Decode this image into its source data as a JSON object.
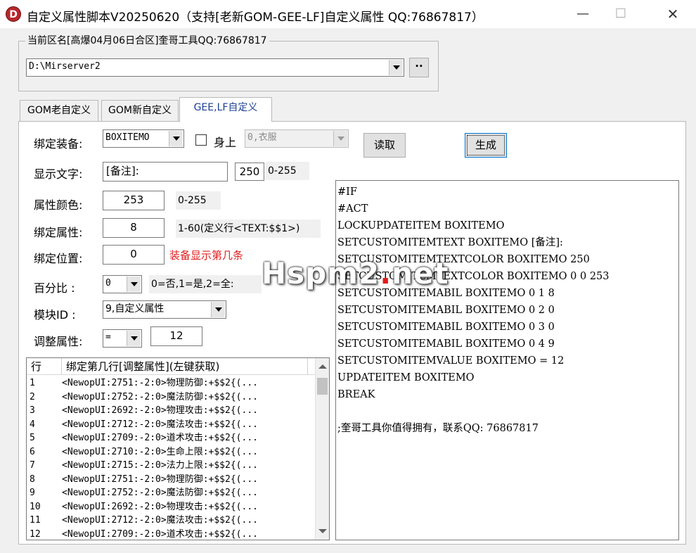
{
  "window": {
    "title": "自定义属性脚本V20250620（支持[老新GOM-GEE-LF]自定义属性 QQ:76867817）",
    "icon_letter": "D",
    "minimize": "—",
    "maximize": "☐",
    "close": "✕"
  },
  "server_group": {
    "legend": "当前区名[高爆04月06日合区]奎哥工具QQ:76867817",
    "path": "D:\\Mirserver2",
    "browse_label": "··"
  },
  "tabs": [
    {
      "label": "GOM老自定义"
    },
    {
      "label": "GOM新自定义"
    },
    {
      "label": "GEE,LF自定义"
    }
  ],
  "form": {
    "bind_equip_label": "绑定装备:",
    "bind_equip_value": "BOXITEMO",
    "on_body_label": "身上",
    "on_body_value": "0,衣服",
    "read_button": "读取",
    "generate_button": "生成",
    "display_text_label": "显示文字:",
    "display_text_value": "[备注]:",
    "display_num": "250",
    "display_range": "0-255",
    "attr_color_label": "属性颜色:",
    "attr_color_value": "253",
    "attr_color_range": "0-255",
    "bind_attr_label": "绑定属性:",
    "bind_attr_value": "8",
    "bind_attr_hint": "1-60(定义行<TEXT:$$1>)",
    "bind_pos_label": "绑定位置:",
    "bind_pos_value": "0",
    "bind_pos_hint": "装备显示第几条",
    "percent_label": "百分比  :",
    "percent_value": "0",
    "percent_hint": "0=否,1=是,2=全:",
    "module_label": "模块ID  :",
    "module_value": "9,自定义属性",
    "adjust_label": "调整属性:",
    "adjust_op": "=",
    "adjust_value": "12"
  },
  "list": {
    "col_row": "行",
    "col_desc": "绑定第几行[调整属性](左键获取)",
    "rows": [
      {
        "n": "1",
        "text": "<NewopUI:2751:-2:0>物理防御:+$$2{(..."
      },
      {
        "n": "2",
        "text": "<NewopUI:2752:-2:0>魔法防御:+$$2{(..."
      },
      {
        "n": "3",
        "text": "<NewopUI:2692:-2:0>物理攻击:+$$2{(..."
      },
      {
        "n": "4",
        "text": "<NewopUI:2712:-2:0>魔法攻击:+$$2{(..."
      },
      {
        "n": "5",
        "text": "<NewopUI:2709:-2:0>道术攻击:+$$2{(..."
      },
      {
        "n": "6",
        "text": "<NewopUI:2710:-2:0>生命上限:+$$2{(..."
      },
      {
        "n": "7",
        "text": "<NewopUI:2715:-2:0>法力上限:+$$2{(..."
      },
      {
        "n": "8",
        "text": "<NewopUI:2751:-2:0>物理防御:+$$2{(..."
      },
      {
        "n": "9",
        "text": "<NewopUI:2752:-2:0>魔法防御:+$$2{(..."
      },
      {
        "n": "10",
        "text": "<NewopUI:2692:-2:0>物理攻击:+$$2{(..."
      },
      {
        "n": "11",
        "text": "<NewopUI:2712:-2:0>魔法攻击:+$$2{(..."
      },
      {
        "n": "12",
        "text": "<NewopUI:2709:-2:0>道术攻击:+$$2{(..."
      }
    ]
  },
  "code": {
    "lines": [
      "#IF",
      "#ACT",
      "LOCKUPDATEITEM BOXITEMO",
      "SETCUSTOMITEMTEXT BOXITEMO [备注]:",
      "SETCUSTOMITEMTEXTCOLOR BOXITEMO 250",
      "SETCUSTOMITEMTEXTCOLOR BOXITEMO 0 0 253",
      "SETCUSTOMITEMABIL BOXITEMO 0 1 8",
      "SETCUSTOMITEMABIL BOXITEMO 0 2 0",
      "SETCUSTOMITEMABIL BOXITEMO 0 3 0",
      "SETCUSTOMITEMABIL BOXITEMO 0 4 9",
      "SETCUSTOMITEMVALUE BOXITEMO = 12",
      "UPDATEITEM BOXITEMO",
      "BREAK",
      "",
      ";奎哥工具你值得拥有，联系QQ: 76867817"
    ]
  },
  "watermark": {
    "part1": "Hspm2",
    "dot": ".",
    "part2": "net"
  },
  "colors": {
    "hint_red": "#e02020",
    "active_tab_text": "#1c3f94",
    "icon_bg": "#b7262b"
  }
}
